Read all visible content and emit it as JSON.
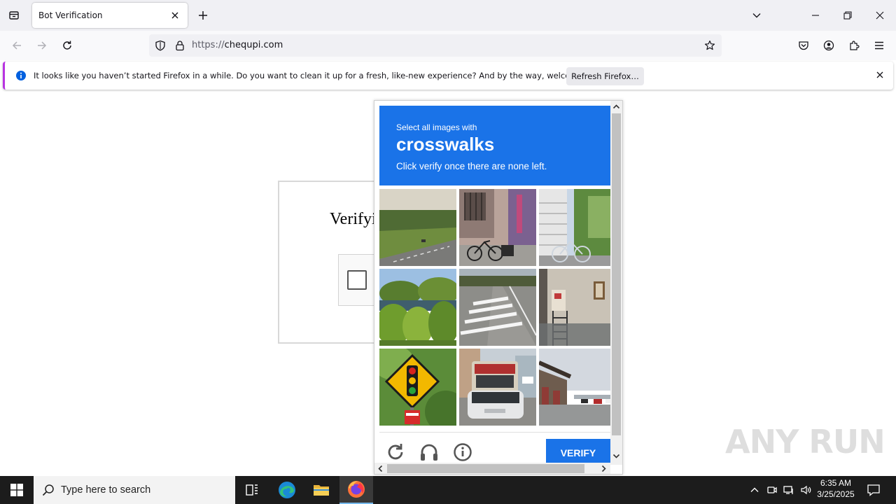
{
  "browser": {
    "tab_title": "Bot Verification",
    "url_scheme": "https://",
    "url_host": "chequpi.com"
  },
  "notification": {
    "message": "It looks like you haven’t started Firefox in a while. Do you want to clean it up for a fresh, like-new experience? And by the way, welcome back!",
    "button_label": "Refresh Firefox…"
  },
  "page": {
    "heading": "Verifyi"
  },
  "captcha": {
    "instruction": "Select all images with",
    "target": "crosswalks",
    "note": "Click verify once there are none left.",
    "verify_label": "VERIFY",
    "tiles": [
      "highway",
      "bicycle-doorway",
      "bicycle-fence",
      "bushes-pond",
      "crosswalk-road",
      "building-stairs",
      "traffic-signal-sign",
      "minivan-street",
      "parking-buildings"
    ],
    "header_color": "#1a73e8"
  },
  "watermark": "ANY RUN",
  "taskbar": {
    "search_placeholder": "Type here to search",
    "time": "6:35 AM",
    "date": "3/25/2025"
  }
}
